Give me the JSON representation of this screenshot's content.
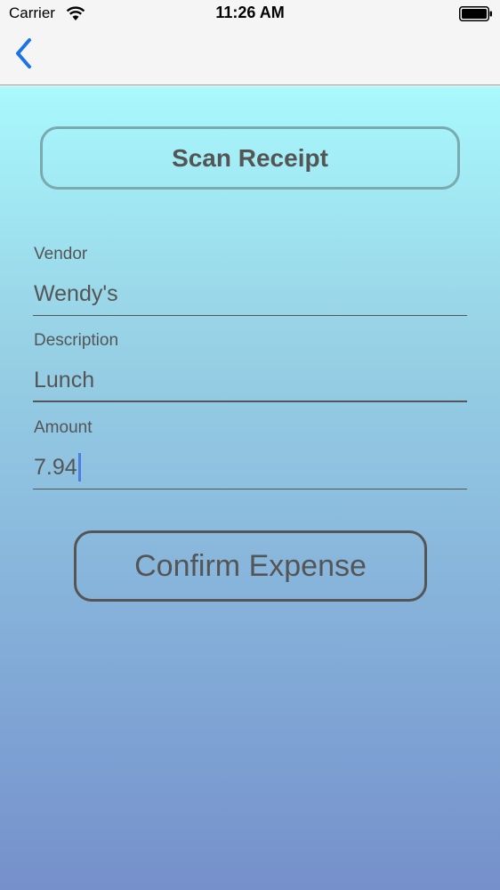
{
  "status_bar": {
    "carrier": "Carrier",
    "time": "11:26 AM",
    "wifi_icon": "wifi-icon",
    "battery_icon": "battery-icon"
  },
  "nav": {
    "back_icon": "chevron-left-icon",
    "accent_color": "#1a73e8"
  },
  "scan_button": {
    "label": "Scan Receipt"
  },
  "form": {
    "vendor": {
      "label": "Vendor",
      "value": "Wendy's"
    },
    "description": {
      "label": "Description",
      "value": "Lunch"
    },
    "amount": {
      "label": "Amount",
      "value": "7.94"
    }
  },
  "confirm_button": {
    "label": "Confirm Expense"
  },
  "colors": {
    "gradient_top": "#a9f9fd",
    "gradient_bottom": "#7590cb",
    "text": "#555555",
    "caret": "#4a7fe0"
  }
}
